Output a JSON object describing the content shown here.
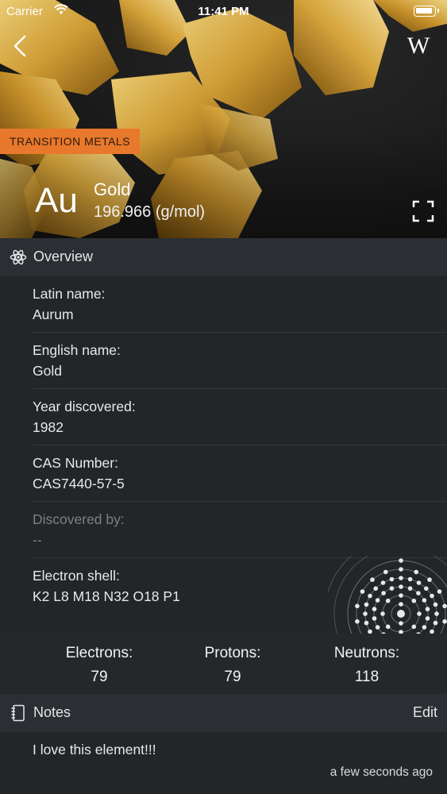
{
  "status_bar": {
    "carrier": "Carrier",
    "time": "11:41 PM",
    "icons": [
      "wifi-icon",
      "battery-icon"
    ]
  },
  "hero": {
    "category": "TRANSITION METALS",
    "category_color": "#e8782c",
    "symbol": "Au",
    "name": "Gold",
    "atomic_mass": "196.966 (g/mol)",
    "wiki_label": "W",
    "icons": [
      "back-icon",
      "wikipedia-icon",
      "expand-icon"
    ]
  },
  "overview": {
    "title": "Overview",
    "icon": "atom-icon",
    "rows": [
      {
        "label": "Latin name:",
        "value": "Aurum"
      },
      {
        "label": "English name:",
        "value": "Gold"
      },
      {
        "label": "Year discovered:",
        "value": "1982"
      },
      {
        "label": "CAS Number:",
        "value": "CAS7440-57-5"
      },
      {
        "label": "Discovered by:",
        "value": "--"
      },
      {
        "label": "Electron shell:",
        "value": "K2 L8 M18 N32 O18 P1"
      }
    ]
  },
  "counts": {
    "electrons_label": "Electrons:",
    "electrons": "79",
    "protons_label": "Protons:",
    "protons": "79",
    "neutrons_label": "Neutrons:",
    "neutrons": "118"
  },
  "notes": {
    "title": "Notes",
    "icon": "notebook-icon",
    "edit_label": "Edit",
    "text": "I love this element!!!",
    "timestamp": "a few seconds ago"
  },
  "colors": {
    "background": "#222629",
    "section_header": "#2b2f33",
    "accent": "#e8782c"
  }
}
